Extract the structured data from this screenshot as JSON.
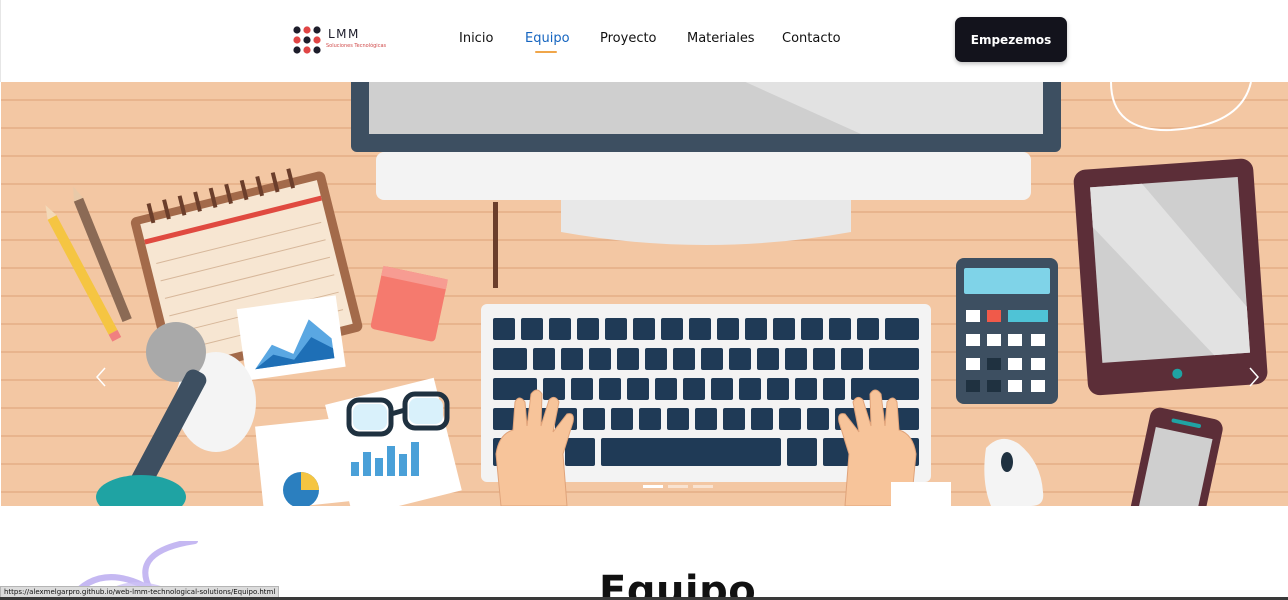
{
  "brand": {
    "name": "LMM",
    "tagline": "Soluciones Tecnológicas"
  },
  "nav": {
    "items": [
      {
        "label": "Inicio",
        "active": false
      },
      {
        "label": "Equipo",
        "active": true
      },
      {
        "label": "Proyecto",
        "active": false
      },
      {
        "label": "Materiales",
        "active": false
      },
      {
        "label": "Contacto",
        "active": false
      }
    ]
  },
  "cta": {
    "label": "Empezemos"
  },
  "hero": {
    "icons": {
      "prev": "chevron-left-icon",
      "next": "chevron-right-icon"
    },
    "slides_total": 3,
    "active_slide": 1
  },
  "section": {
    "title": "Equipo"
  },
  "status_bar": {
    "url": "https://alexmelgarpro.github.io/web-lmm-technological-solutions/Equipo.html"
  },
  "colors": {
    "accent": "#1565c0",
    "underline": "#f0a64a",
    "cta_bg": "#13131c",
    "hero_bg": "#f3c7a3"
  }
}
